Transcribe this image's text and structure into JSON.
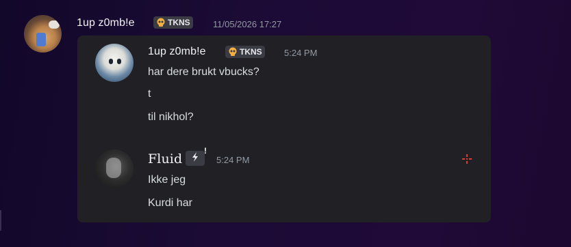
{
  "outer_message": {
    "author": "1up z0mb!e",
    "tag": "TKNS",
    "timestamp": "11/05/2026 17:27"
  },
  "forwarded": [
    {
      "author": "1up z0mb!e",
      "tag": "TKNS",
      "time": "5:24 PM",
      "lines": [
        "har dere brukt vbucks?",
        "t",
        "til nikhol?"
      ]
    },
    {
      "author": "Fluid",
      "tag_icon": "lightning-bolt-icon",
      "tag_extra": "!",
      "time": "5:24 PM",
      "lines": [
        "Ikke jeg",
        "Kurdi har"
      ]
    }
  ],
  "colors": {
    "background_start": "#12082a",
    "background_end": "#200a38",
    "card": "#202025",
    "tag_bg": "#3a3b43",
    "timestamp": "#949ba4",
    "reticle": "#e53935",
    "skull": "#f5b041"
  }
}
